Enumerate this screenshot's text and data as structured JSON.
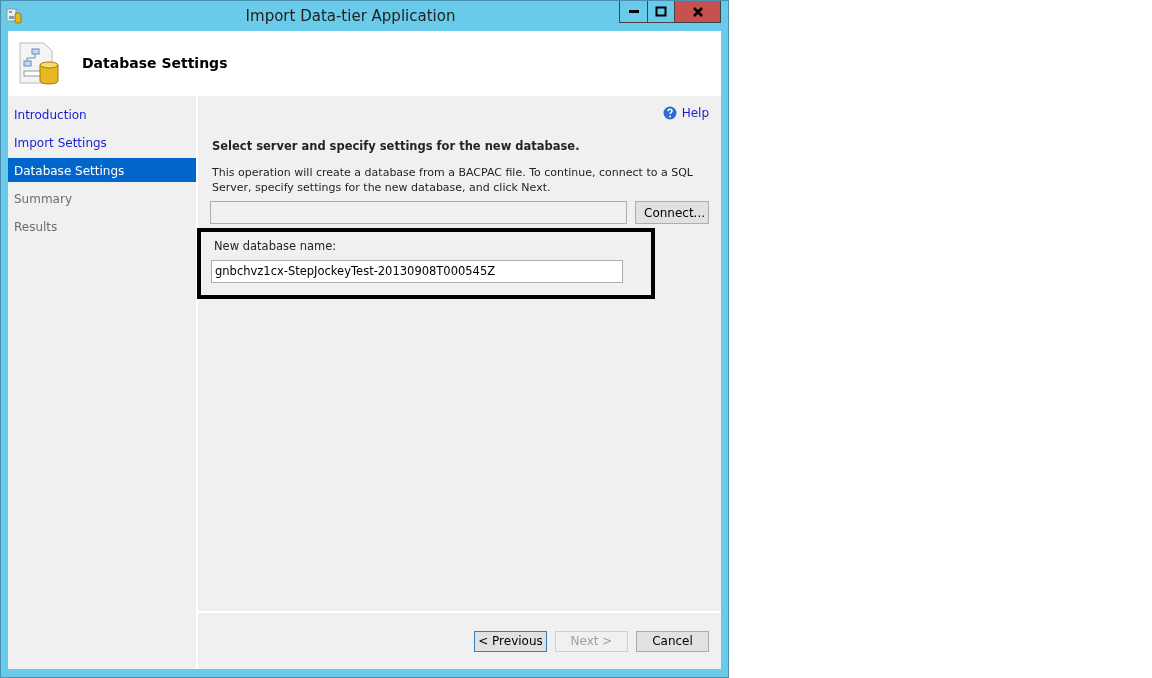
{
  "window": {
    "title": "Import Data-tier Application"
  },
  "header": {
    "title": "Database Settings"
  },
  "sidebar": {
    "items": [
      {
        "label": "Introduction",
        "selected": false,
        "enabled": true
      },
      {
        "label": "Import Settings",
        "selected": false,
        "enabled": true
      },
      {
        "label": "Database Settings",
        "selected": true,
        "enabled": true
      },
      {
        "label": "Summary",
        "selected": false,
        "enabled": false
      },
      {
        "label": "Results",
        "selected": false,
        "enabled": false
      }
    ]
  },
  "help": {
    "label": "Help"
  },
  "content": {
    "heading": "Select server and specify settings for the new database.",
    "description": "This operation will create a database from a BACPAC file. To continue, connect to a SQL Server, specify settings for the new database, and click Next.",
    "connect_button": "Connect...",
    "database_name": {
      "label": "New database name:",
      "value": "gnbchvz1cx-StepJockeyTest-20130908T000545Z"
    }
  },
  "footer": {
    "buttons": [
      {
        "label": "< Previous",
        "disabled": false,
        "default": true
      },
      {
        "label": "Next >",
        "disabled": true,
        "default": false
      },
      {
        "label": "Cancel",
        "disabled": false,
        "default": false
      }
    ]
  }
}
